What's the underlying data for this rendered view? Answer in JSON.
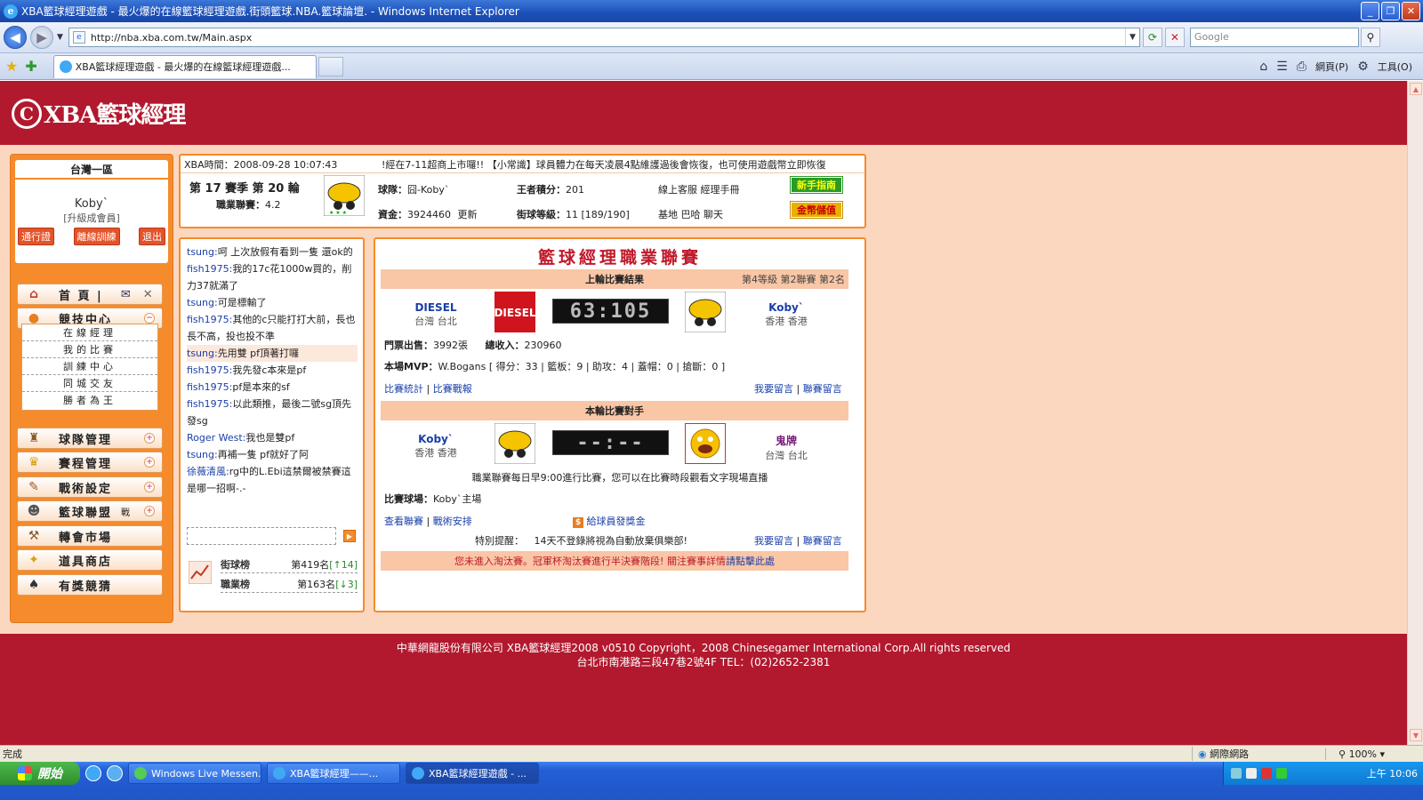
{
  "window": {
    "title": "XBA籃球經理遊戲 - 最火爆的在線籃球經理遊戲.街頭籃球.NBA.籃球論壇. - Windows Internet Explorer",
    "url": "http://nba.xba.com.tw/Main.aspx",
    "search_placeholder": "Google",
    "tab_title": "XBA籃球經理遊戲 - 最火爆的在線籃球經理遊戲...",
    "cmd_page": "網頁(P)",
    "cmd_tools": "工具(O)"
  },
  "site": {
    "logo_text": "XBA籃球經理",
    "logo_mark": "C"
  },
  "user": {
    "region": "台灣一區",
    "name": "Koby`",
    "level": "[升級成會員]",
    "btn_pass": "通行證",
    "btn_offline": "離線訓練",
    "btn_logout": "退出"
  },
  "menu": {
    "home": "首 頁 |",
    "arena": "競技中心",
    "team_mgmt": "球隊管理",
    "schedule_mgmt": "賽程管理",
    "tactics": "戰術設定",
    "league": "籃球聯盟",
    "league_badge": "戰",
    "transfer": "轉會市場",
    "shop": "道具商店",
    "lottery": "有獎競猜",
    "sub": [
      "在線經理",
      "我的比賽",
      "訓練中心",
      "同城交友",
      "勝者為王"
    ]
  },
  "info": {
    "time": "XBA時間：2008-09-28 10:07:43",
    "ticker": "!經在7-11超商上市囉!! 【小常識】球員體力在每天凌晨4點維護過後會恢復，也可使用遊戲幣立即恢復",
    "season": "第 17 賽季  第 20 輪",
    "league_rank_label": "職業聯賽：",
    "league_rank_value": "4.2",
    "team_label": "球隊：",
    "team_value": "囧-Koby`",
    "king_label": "王者積分：",
    "king_value": "201",
    "links_1": "線上客服  經理手冊",
    "funds_label": "資金：",
    "funds_value": "3924460",
    "funds_update": "更新",
    "street_label": "街球等級：",
    "street_value": "11 [189/190]",
    "links_2": "基地  巴哈  聊天",
    "guide_btn": "新手指南",
    "gold_btn": "金幣儲值"
  },
  "chat": {
    "messages": [
      {
        "nick": "tsung:",
        "text": "呵  上次放假有看到一隻  還ok的"
      },
      {
        "nick": "fish1975:",
        "text": "我的17c花1000w買的，削力37就滿了"
      },
      {
        "nick": "tsung:",
        "text": "可是標輸了"
      },
      {
        "nick": "fish1975:",
        "text": "其他的c只能打打大前，長也長不高，投也投不準"
      },
      {
        "nick": "tsung:",
        "text": "先用雙  pf頂著打囉"
      },
      {
        "nick": "fish1975:",
        "text": "我先發c本來是pf"
      },
      {
        "nick": "fish1975:",
        "text": "pf是本來的sf"
      },
      {
        "nick": "fish1975:",
        "text": "以此類推，最後二號sg頂先發sg"
      },
      {
        "nick": "Roger West:",
        "text": "我也是雙pf"
      },
      {
        "nick": "tsung:",
        "text": "再補一隻  pf就好了阿"
      },
      {
        "nick": "徐薇清風:",
        "text": "rg中的L.Ebi這禁爾被禁賽這是哪一招啊-.-"
      }
    ],
    "rank_street_label": "街球榜",
    "rank_street_value": "第419名",
    "rank_street_change": "[↑14]",
    "rank_pro_label": "職業榜",
    "rank_pro_value": "第163名",
    "rank_pro_change": "[↓3]"
  },
  "league": {
    "title": "籃球經理職業聯賽",
    "last_header": "上輪比賽結果",
    "last_info": "第4等級  第2聯賽  第2名",
    "home_team": "DIESEL",
    "home_loc": "台灣  台北",
    "score": "63:105",
    "away_team": "Koby`",
    "away_loc": "香港  香港",
    "tickets_label": "門票出售：",
    "tickets_value": "3992張",
    "income_label": "總收入：",
    "income_value": "230960",
    "mvp_label": "本場MVP：",
    "mvp_value": "W.Bogans [ 得分：33 | 籃板：9 | 助攻：4 | 蓋帽：0 | 搶斷：0 ]",
    "link_stats": "比賽統計",
    "link_report": "比賽戰報",
    "link_msg": "我要留言",
    "link_league_msg": "聯賽留言",
    "next_header": "本輪比賽對手",
    "next_home": "Koby`",
    "next_home_loc": "香港  香港",
    "next_score": "--:--",
    "next_away": "鬼牌",
    "next_away_loc": "台灣  台北",
    "next_note": "職業聯賽每日早9:00進行比賽，您可以在比賽時段觀看文字現場直播",
    "venue_label": "比賽球場：",
    "venue_value": "Koby`主場",
    "link_view_league": "查看聯賽",
    "link_tactics": "戰術安排",
    "bonus": "給球員發獎金",
    "notice_label": "特別提醒：",
    "notice_value": "14天不登錄將視為自動放棄俱樂部!",
    "link_msg2": "我要留言",
    "link_league_msg2": "聯賽留言",
    "bottom_notice": "您未進入淘汰賽。冠軍杯淘汰賽進行半決賽階段! 關注賽事詳情",
    "bottom_link": "請點擊此處"
  },
  "footer": {
    "line1": "中華網龍股份有限公司  XBA籃球經理2008 v0510    Copyright，2008 Chinesegamer International Corp.All rights reserved",
    "line2": "台北市南港路三段47巷2號4F TEL：(02)2652-2381"
  },
  "status": {
    "text": "完成",
    "zone": "網際網路",
    "zoom": "100%"
  },
  "taskbar": {
    "start": "開始",
    "tasks": [
      "Windows Live Messen...",
      "XBA籃球經理——...",
      "XBA籃球經理遊戲 - ..."
    ],
    "clock": "上午 10:06"
  },
  "colors": {
    "brand_red": "#b2192e",
    "orange": "#f58b2a",
    "page_bg": "#fbd7c0"
  }
}
